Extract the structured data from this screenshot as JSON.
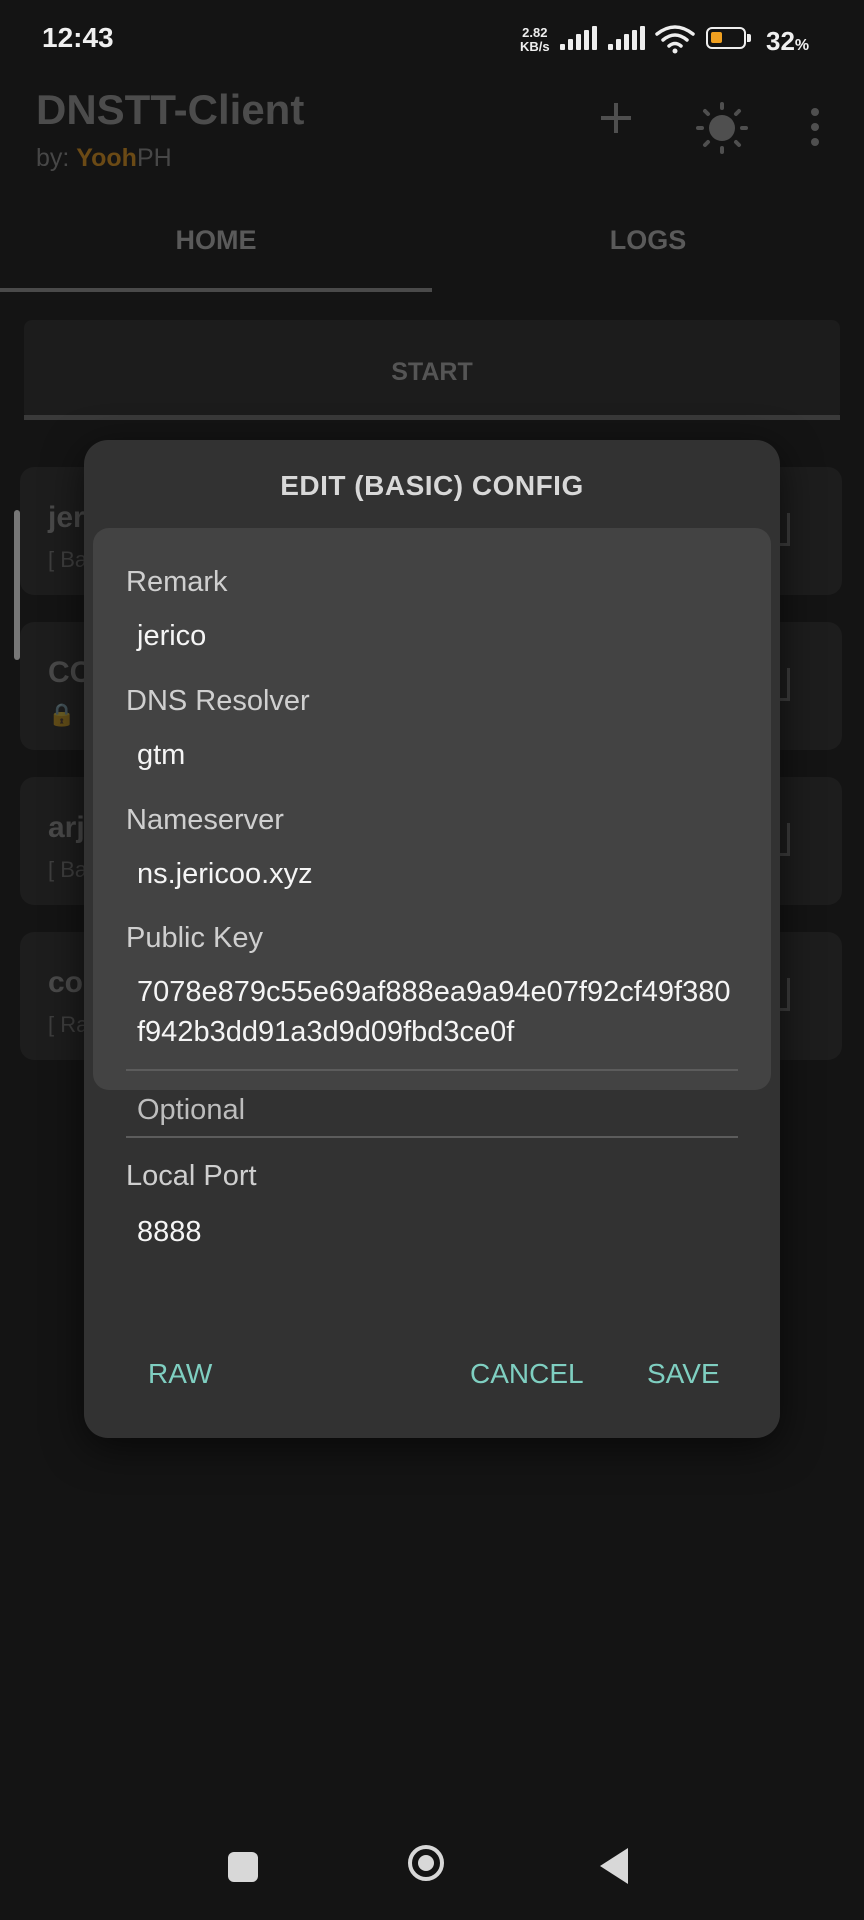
{
  "status_bar": {
    "time": "12:43",
    "net_speed_value": "2.82",
    "net_speed_unit": "KB/s",
    "battery_percent": "32",
    "battery_symbol": "%",
    "icons": [
      "signal-icon",
      "signal-icon",
      "wifi-icon",
      "battery-icon"
    ]
  },
  "app_bar": {
    "title": "DNSTT-Client",
    "subtitle_prefix": "by: ",
    "subtitle_highlight": "Yooh",
    "subtitle_suffix": "PH",
    "actions": [
      "add-icon",
      "brightness-icon",
      "more-vert-icon"
    ]
  },
  "tabs": [
    {
      "label": "HOME",
      "active": true
    },
    {
      "label": "LOGS",
      "active": false
    }
  ],
  "start_button": {
    "label": "START"
  },
  "config_cards": [
    {
      "name": "jer",
      "sub": "[ Ba"
    },
    {
      "name": "CO",
      "sub": "🔒"
    },
    {
      "name": "arj",
      "sub": "[ Ba"
    },
    {
      "name": "co",
      "sub": "[ Ra"
    }
  ],
  "dialog": {
    "title": "EDIT (BASIC) CONFIG",
    "fields": {
      "remark_label": "Remark",
      "remark_value": "jerico",
      "dns_label": "DNS Resolver",
      "dns_value": "gtm",
      "nameserver_label": "Nameserver",
      "nameserver_value": "ns.jericoo.xyz",
      "pubkey_label": "Public Key",
      "pubkey_value": "7078e879c55e69af888ea9a94e07f92cf49f380f942b3dd91a3d9d09fbd3ce0f",
      "optional_label": "Optional",
      "port_label": "Local Port",
      "port_value": "8888"
    },
    "actions": {
      "raw": "RAW",
      "cancel": "CANCEL",
      "save": "SAVE"
    }
  },
  "colors": {
    "accent": "#7fcfc1",
    "dialog_bg": "#323232",
    "form_bg": "#434343",
    "brand_yellow": "#6b4a15"
  }
}
